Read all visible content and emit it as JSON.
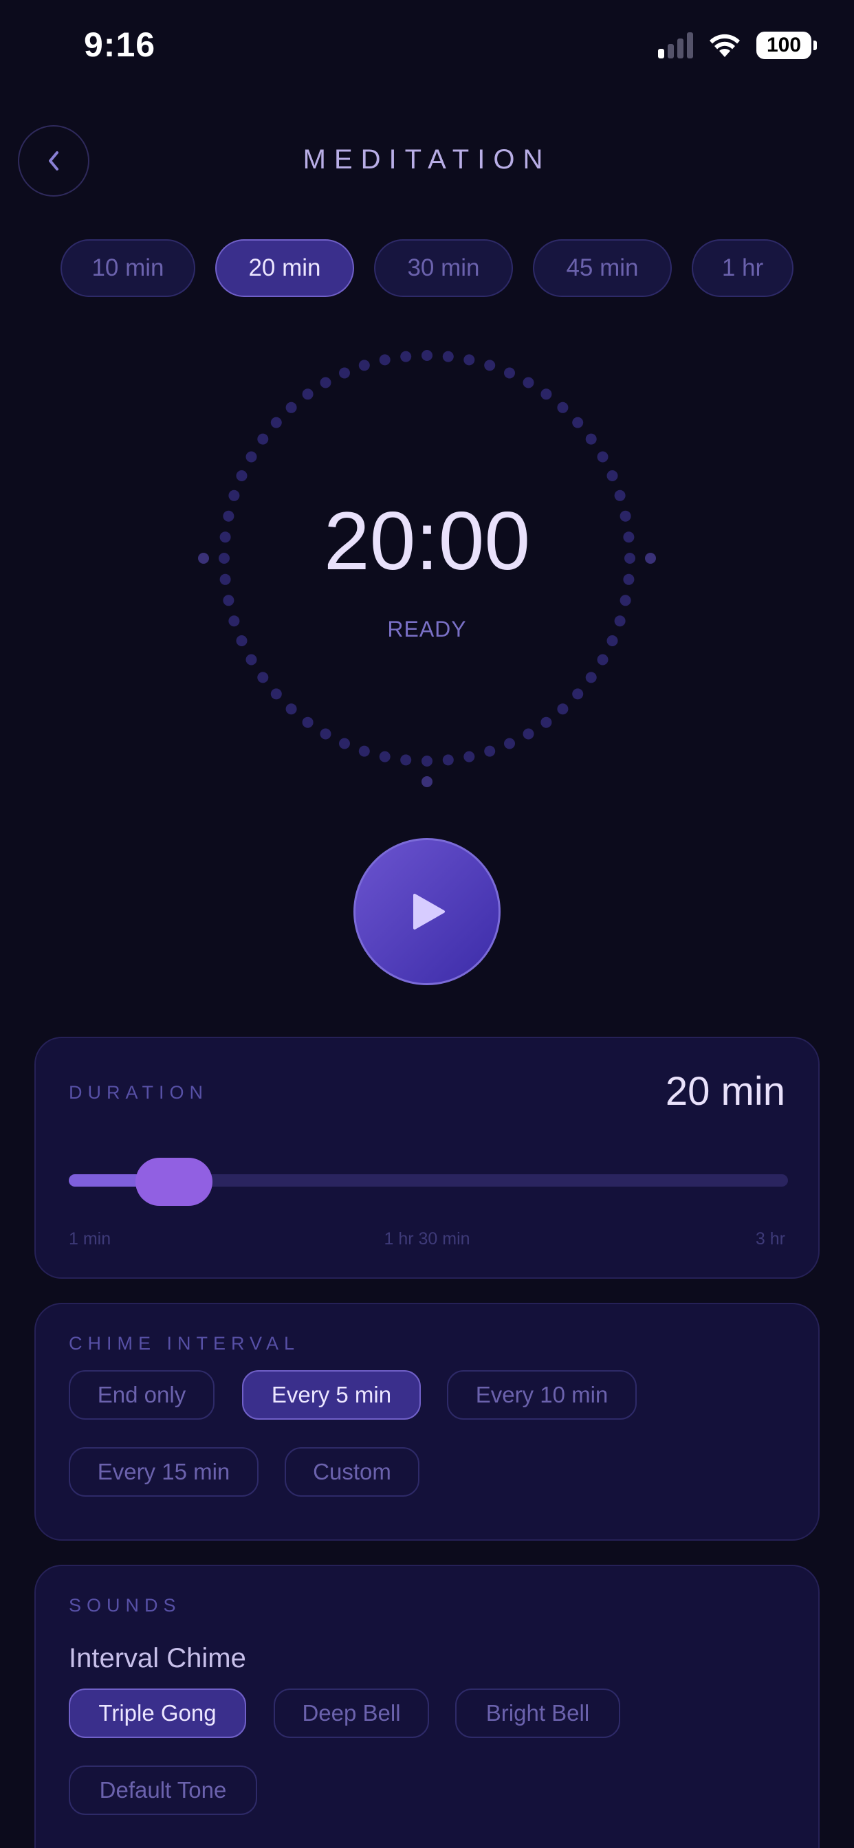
{
  "status_bar": {
    "time": "9:16",
    "battery": "100",
    "signal_bars_active": 1,
    "signal_bars_total": 4
  },
  "header": {
    "title": "MEDITATION",
    "back_icon": "chevron-left-icon"
  },
  "presets": [
    {
      "label": "10 min",
      "active": false
    },
    {
      "label": "20 min",
      "active": true
    },
    {
      "label": "30 min",
      "active": false
    },
    {
      "label": "45 min",
      "active": false
    },
    {
      "label": "1 hr",
      "active": false
    }
  ],
  "timer": {
    "value": "20:00",
    "status": "READY"
  },
  "play_button": {
    "icon": "play-icon"
  },
  "duration": {
    "label": "DURATION",
    "value": "20 min",
    "slider_min_label": "1 min",
    "slider_mid_label": "1 hr 30 min",
    "slider_max_label": "3 hr",
    "slider_fraction": 0.106
  },
  "chime_interval": {
    "label": "CHIME INTERVAL",
    "options": [
      {
        "label": "End only",
        "active": false
      },
      {
        "label": "Every 5 min",
        "active": true
      },
      {
        "label": "Every 10 min",
        "active": false
      },
      {
        "label": "Every 15 min",
        "active": false
      },
      {
        "label": "Custom",
        "active": false
      }
    ]
  },
  "sounds": {
    "label": "SOUNDS",
    "interval_chime_heading": "Interval Chime",
    "options": [
      {
        "label": "Triple Gong",
        "active": true
      },
      {
        "label": "Deep Bell",
        "active": false
      },
      {
        "label": "Bright Bell",
        "active": false
      },
      {
        "label": "Default Tone",
        "active": false
      }
    ]
  },
  "colors": {
    "background": "#0c0b1c",
    "accent": "#3a2f8c",
    "accent_border": "#7060c8",
    "ring_dots": "#2a2466"
  }
}
